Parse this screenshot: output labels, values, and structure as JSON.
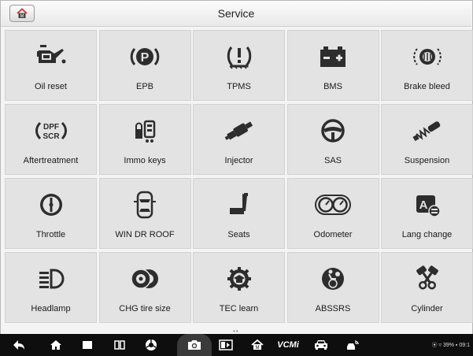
{
  "header": {
    "title": "Service",
    "home_icon": "home-icon"
  },
  "tiles": [
    {
      "label": "Oil reset",
      "icon": "oil-can-icon"
    },
    {
      "label": "EPB",
      "icon": "parking-brake-icon"
    },
    {
      "label": "TPMS",
      "icon": "tire-pressure-icon"
    },
    {
      "label": "BMS",
      "icon": "battery-icon"
    },
    {
      "label": "Brake bleed",
      "icon": "brake-bleed-icon"
    },
    {
      "label": "Aftertreatment",
      "icon": "dpf-scr-icon"
    },
    {
      "label": "Immo keys",
      "icon": "immo-keys-icon"
    },
    {
      "label": "Injector",
      "icon": "injector-icon"
    },
    {
      "label": "SAS",
      "icon": "steering-wheel-icon"
    },
    {
      "label": "Suspension",
      "icon": "shock-absorber-icon"
    },
    {
      "label": "Throttle",
      "icon": "throttle-icon"
    },
    {
      "label": "WIN DR ROOF",
      "icon": "car-top-view-icon"
    },
    {
      "label": "Seats",
      "icon": "seat-icon"
    },
    {
      "label": "Odometer",
      "icon": "odometer-icon"
    },
    {
      "label": "Lang change",
      "icon": "language-icon"
    },
    {
      "label": "Headlamp",
      "icon": "headlamp-icon"
    },
    {
      "label": "CHG tire size",
      "icon": "tire-size-icon"
    },
    {
      "label": "TEC learn",
      "icon": "tec-learn-icon"
    },
    {
      "label": "ABSSRS",
      "icon": "abs-srs-icon"
    },
    {
      "label": "Cylinder",
      "icon": "cylinder-icon"
    }
  ],
  "pager": "••",
  "navbar": {
    "items": [
      "back-icon",
      "home-icon",
      "recent-apps-icon",
      "split-screen-icon",
      "browser-icon",
      "camera-icon",
      "vci-icon",
      "autel-home-icon",
      "vcmi-icon",
      "car-icon",
      "remote-diagnostics-icon"
    ],
    "vcmi_label": "VCMi",
    "status_text": "⦿ ▿ 39% ▪ 09:1"
  }
}
